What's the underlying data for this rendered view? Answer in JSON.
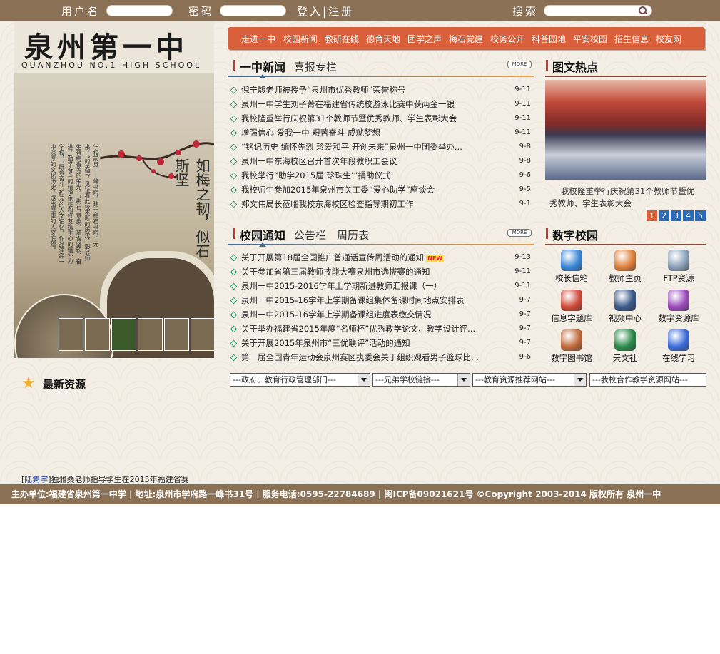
{
  "topbar": {
    "username_label": "用户名",
    "password_label": "密码",
    "login_register": "登入|注册",
    "search_label": "搜索"
  },
  "banner": {
    "school_name_cn": "泉州第一中学",
    "school_name_en": "QUANZHOU NO.1 HIGH SCHOOL",
    "motto": "如梅之韧，似石斯坚",
    "intro": "学校前身——峰书院，建于梅石书院。元来，“的美德，见证着此校不断的历史，彰显师生普梅香等的荣光，“梅石”意象，蕴含坚毅、奋进，勤学奋斗的精神象征和校友携手心的情怀为学校，“既含奋斗”积淀的人文记忆，作品演绎一中深厚的文化历史，透出厚重的人文底蕴。"
  },
  "nav": {
    "items": [
      "走进一中",
      "校园新闻",
      "教研在线",
      "德育天地",
      "团学之声",
      "梅石党建",
      "校务公开",
      "科普园地",
      "平安校园",
      "招生信息",
      "校友网"
    ]
  },
  "news": {
    "tab_main": "一中新闻",
    "tab_sub": "喜报专栏",
    "more": "MORE",
    "items": [
      {
        "title": "倪宁馥老师被授予“泉州市优秀教师”荣誉称号",
        "date": "9-11"
      },
      {
        "title": "泉州一中学生刘子菁在福建省传统校游泳比赛中获两金一银",
        "date": "9-11"
      },
      {
        "title": "我校隆重举行庆祝第31个教师节暨优秀教师、学生表彰大会",
        "date": "9-11"
      },
      {
        "title": "增强信心  爱我一中  艰苦奋斗  成就梦想",
        "date": "9-11"
      },
      {
        "title": "“铭记历史  缅怀先烈  珍爱和平  开创未来”泉州一中团委举办...",
        "date": "9-8"
      },
      {
        "title": "泉州一中东海校区召开首次年段教职工会议",
        "date": "9-8"
      },
      {
        "title": "我校举行“助学2015届‘珍珠生’”捐助仪式",
        "date": "9-6"
      },
      {
        "title": "我校师生参加2015年泉州市关工委“爱心助学”座谈会",
        "date": "9-5"
      },
      {
        "title": "郑文伟局长莅临我校东海校区检查指导期初工作",
        "date": "9-1"
      }
    ]
  },
  "hot": {
    "title": "图文热点",
    "caption": "我校隆重举行庆祝第31个教师节暨优秀教师、学生表彰大会",
    "pages": [
      "1",
      "2",
      "3",
      "4",
      "5"
    ]
  },
  "notice": {
    "tab_main": "校园通知",
    "tab_sub1": "公告栏",
    "tab_sub2": "周历表",
    "more": "MORE",
    "new_badge": "NEW",
    "items": [
      {
        "title": "关于开展第18届全国推广普通话宣传周活动的通知",
        "date": "9-13",
        "is_new": true
      },
      {
        "title": "关于参加省第三届教师技能大赛泉州市选拔赛的通知",
        "date": "9-11"
      },
      {
        "title": "泉州一中2015-2016学年上学期新进教师汇报课（一）",
        "date": "9-11"
      },
      {
        "title": "泉州一中2015-16学年上学期备课组集体备课时间地点安排表",
        "date": "9-7"
      },
      {
        "title": "泉州一中2015-16学年上学期备课组进度表缴交情况",
        "date": "9-7"
      },
      {
        "title": "关于举办福建省2015年度“名师杯”优秀教学论文、教学设计评...",
        "date": "9-7"
      },
      {
        "title": "关于开展2015年泉州市“三优联评”活动的通知",
        "date": "9-7"
      },
      {
        "title": "第一届全国青年运动会泉州赛区执委会关于组织观看男子篮球比...",
        "date": "9-6"
      }
    ]
  },
  "digital": {
    "title": "数字校园",
    "items": [
      {
        "label": "校长信箱",
        "icon": "ie-globe-icon",
        "color": "#3a86d8"
      },
      {
        "label": "教师主页",
        "icon": "home-icon",
        "color": "#e0803a"
      },
      {
        "label": "FTP资源",
        "icon": "server-icon",
        "color": "#8aa0b8"
      },
      {
        "label": "信息学题库",
        "icon": "books-ribbon-icon",
        "color": "#d04a3a"
      },
      {
        "label": "视频中心",
        "icon": "film-icon",
        "color": "#3a5a8a"
      },
      {
        "label": "数字资源库",
        "icon": "blocks-icon",
        "color": "#9a4ab8"
      },
      {
        "label": "数字图书馆",
        "icon": "books-icon",
        "color": "#c06a3a"
      },
      {
        "label": "天文社",
        "icon": "earth-icon",
        "color": "#2a8a4a"
      },
      {
        "label": "在线学习",
        "icon": "network-icon",
        "color": "#3a6ad8"
      }
    ]
  },
  "links": {
    "gov": "---政府、教育行政管理部门---",
    "schools": "---兄弟学校链接---",
    "resources": "---教育资源推荐网站---",
    "partners": "---我校合作教学资源网站---"
  },
  "latest": {
    "title": "最新资源",
    "scroll_who": "陆隽宇",
    "scroll_text": "]独雅桑老师指导学生在2015年福建省赛"
  },
  "footer": {
    "text": "主办单位:福建省泉州第一中学  |  地址:泉州市学府路一峰书31号  |  服务电话:0595-22784689  |  闽ICP备09021621号  ©Copyright 2003-2014  版权所有  泉州一中"
  }
}
